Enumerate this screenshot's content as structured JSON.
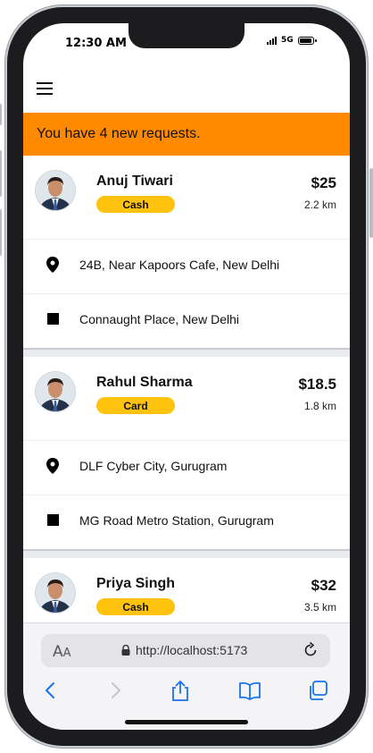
{
  "status_bar": {
    "time": "12:30 AM",
    "network": "5G",
    "icons": [
      "signal-icon",
      "battery-icon"
    ]
  },
  "header": {
    "menu_icon": "hamburger-menu-icon"
  },
  "banner": {
    "text": "You have 4 new requests.",
    "color": "#ff8a00"
  },
  "requests": [
    {
      "name": "Anuj Tiwari",
      "payment": "Cash",
      "price": "$25",
      "distance": "2.2 km",
      "pickup": "24B, Near Kapoors Cafe, New Delhi",
      "dropoff": "Connaught Place, New Delhi"
    },
    {
      "name": "Rahul Sharma",
      "payment": "Card",
      "price": "$18.5",
      "distance": "1.8 km",
      "pickup": "DLF Cyber City, Gurugram",
      "dropoff": "MG Road Metro Station, Gurugram"
    },
    {
      "name": "Priya Singh",
      "payment": "Cash",
      "price": "$32",
      "distance": "3.5 km"
    }
  ],
  "browser": {
    "text_size_label_big": "A",
    "text_size_label_small": "A",
    "url": "http://localhost:5173",
    "icons": [
      "lock-icon",
      "reload-icon",
      "back-icon",
      "forward-icon",
      "share-icon",
      "bookmarks-icon",
      "tabs-icon"
    ]
  },
  "colors": {
    "accent": "#ff8a00",
    "badge": "#ffc20e",
    "ios_blue": "#1a73e8"
  }
}
